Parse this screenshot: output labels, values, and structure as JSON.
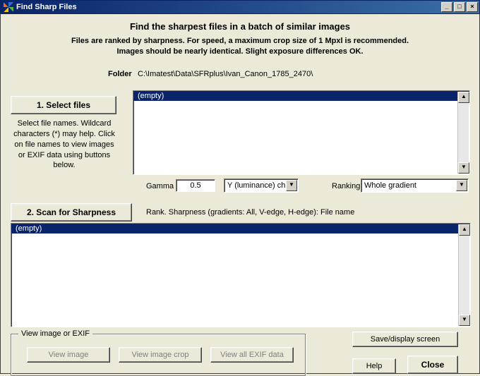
{
  "window": {
    "title": "Find Sharp Files"
  },
  "heading": "Find the sharpest files in a batch of similar images",
  "subtext_line1": "Files are ranked by sharpness.  For speed, a maximum crop size of 1 Mpxl is recommended.",
  "subtext_line2": "Images should be nearly identical.  Slight exposure differences OK.",
  "folder": {
    "label": "Folder",
    "path": "C:\\Imatest\\Data\\SFRplus\\Ivan_Canon_1785_2470\\"
  },
  "section1": {
    "button": "1. Select files",
    "help": "Select file names. Wildcard characters (*) may help. Click on file names to view images or EXIF data using buttons below.",
    "list_empty": "(empty)"
  },
  "controls": {
    "gamma_label": "Gamma",
    "gamma_value": "0.5",
    "channel_selected": "Y (luminance) chan.",
    "ranking_label": "Ranking",
    "ranking_selected": "Whole gradient"
  },
  "section2": {
    "button": "2. Scan for Sharpness",
    "header": "Rank.  Sharpness (gradients: All, V-edge, H-edge):  File name",
    "list_empty": "(empty)"
  },
  "groupbox": {
    "legend": "View image or EXIF",
    "view_image": "View image",
    "view_crop": "View image crop",
    "view_exif": "View all EXIF data"
  },
  "buttons": {
    "save": "Save/display screen",
    "help": "Help",
    "close": "Close"
  }
}
